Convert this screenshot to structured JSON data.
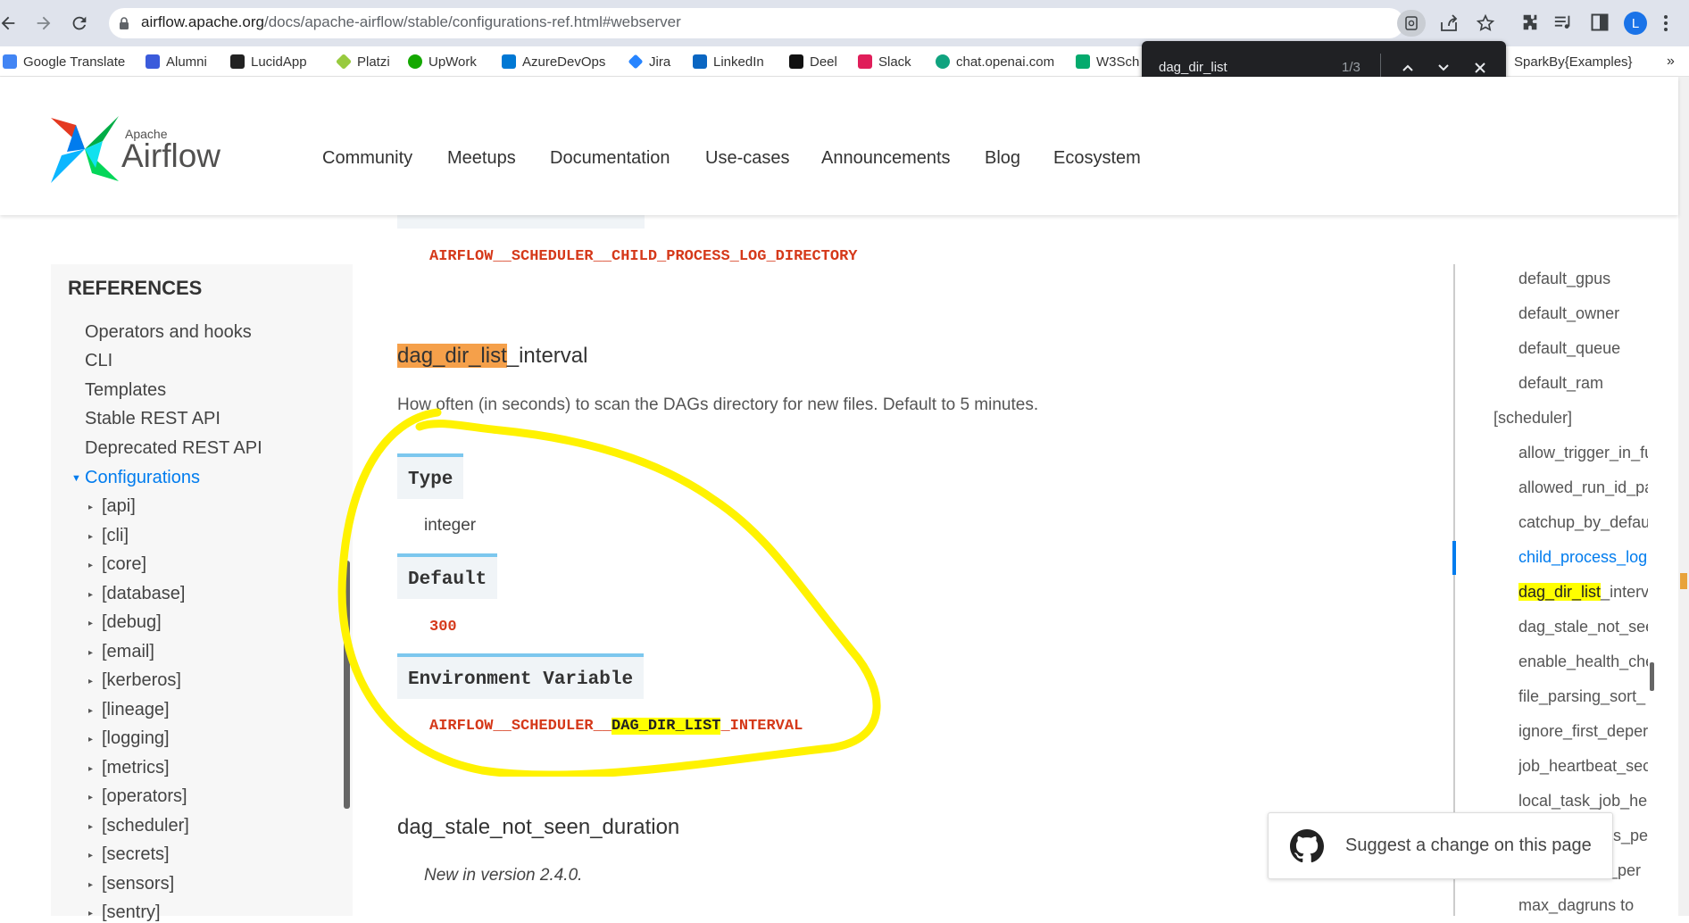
{
  "browser": {
    "url_host": "airflow.apache.org",
    "url_path": "/docs/apache-airflow/stable/configurations-ref.html#webserver",
    "profile_initial": "L"
  },
  "bookmarks": [
    {
      "label": "Google Translate",
      "color": "#4285f4"
    },
    {
      "label": "Alumni",
      "color": "#3b5bdb"
    },
    {
      "label": "LucidApp",
      "color": "#222222"
    },
    {
      "label": "Platzi",
      "color": "#98ca3f"
    },
    {
      "label": "UpWork",
      "color": "#14a800"
    },
    {
      "label": "AzureDevOps",
      "color": "#0078d4"
    },
    {
      "label": "Jira",
      "color": "#2684ff"
    },
    {
      "label": "LinkedIn",
      "color": "#0a66c2"
    },
    {
      "label": "Deel",
      "color": "#111111"
    },
    {
      "label": "Slack",
      "color": "#e01e5a"
    },
    {
      "label": "chat.openai.com",
      "color": "#10a37f"
    },
    {
      "label": "W3Sch",
      "color": "#04aa6d"
    },
    {
      "label": "SparkBy{Examples}",
      "color": "#ffffff"
    }
  ],
  "find": {
    "query": "dag_dir_list",
    "count": "1/3"
  },
  "site": {
    "logo_small": "Apache",
    "logo_big": "Airflow",
    "nav": [
      "Community",
      "Meetups",
      "Documentation",
      "Use-cases",
      "Announcements",
      "Blog",
      "Ecosystem"
    ]
  },
  "sidebar": {
    "heading": "REFERENCES",
    "items": [
      "Operators and hooks",
      "CLI",
      "Templates",
      "Stable REST API",
      "Deprecated REST API"
    ],
    "active": "Configurations",
    "sections": [
      "[api]",
      "[cli]",
      "[core]",
      "[database]",
      "[debug]",
      "[email]",
      "[kerberos]",
      "[lineage]",
      "[logging]",
      "[metrics]",
      "[operators]",
      "[scheduler]",
      "[secrets]",
      "[sensors]",
      "[sentry]"
    ]
  },
  "main": {
    "prev_env_header": "Environment Variable",
    "prev_env_value": "AIRFLOW__SCHEDULER__CHILD_PROCESS_LOG_DIRECTORY",
    "title_highlight": "dag_dir_list",
    "title_rest": "_interval",
    "description": "How often (in seconds) to scan the DAGs directory for new files. Default to 5 minutes.",
    "type_label": "Type",
    "type_value": "integer",
    "default_label": "Default",
    "default_value": "300",
    "env_label": "Environment Variable",
    "env_pre": "AIRFLOW__SCHEDULER__",
    "env_highlight": "DAG_DIR_LIST",
    "env_post": "_INTERVAL",
    "next_title": "dag_stale_not_seen_duration",
    "next_note": "New in version 2.4.0."
  },
  "toc": {
    "items_top": [
      "default_gpus",
      "default_owner",
      "default_queue",
      "default_ram"
    ],
    "section": "[scheduler]",
    "items_a": [
      "allow_trigger_in_fu",
      "allowed_run_id_pa",
      "catchup_by_defau"
    ],
    "active": "child_process_log",
    "hl_highlight": "dag_dir_list",
    "hl_rest": "_interv",
    "items_b": [
      "dag_stale_not_see",
      "enable_health_che",
      "file_parsing_sort_",
      "ignore_first_deper",
      "job_heartbeat_sec",
      "local_task_job_hea",
      "s_pe",
      "s_per",
      "max_dagruns to"
    ]
  },
  "suggest": {
    "label": "Suggest a change on this page"
  },
  "colors": {
    "accent": "#017cee",
    "highlight_orange": "#f5a04a",
    "highlight_yellow": "#ffff00",
    "annotation": "#fff200",
    "env_red": "#d5391a"
  }
}
